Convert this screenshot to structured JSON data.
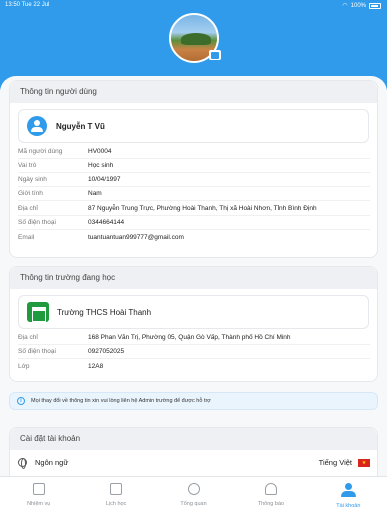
{
  "status_bar": {
    "time": "13:50",
    "date": "Tue 22 Jul",
    "battery": "100%"
  },
  "user_section": {
    "title": "Thông tin người dùng",
    "name": "Nguyễn T Vũ",
    "fields": [
      {
        "label": "Mã người dùng",
        "value": "HV0004"
      },
      {
        "label": "Vai trò",
        "value": "Học sinh"
      },
      {
        "label": "Ngày sinh",
        "value": "10/04/1997"
      },
      {
        "label": "Giới tính",
        "value": "Nam"
      },
      {
        "label": "Địa chỉ",
        "value": "87 Nguyễn Trung Trực, Phường Hoài Thanh, Thị xã Hoài Nhơn, Tỉnh Bình Định"
      },
      {
        "label": "Số điện thoại",
        "value": "0344664144"
      },
      {
        "label": "Email",
        "value": "tuantuantuan999777@gmail.com"
      }
    ]
  },
  "school_section": {
    "title": "Thông tin trường đang học",
    "name": "Trường THCS Hoài Thanh",
    "fields": [
      {
        "label": "Địa chỉ",
        "value": "168 Phan Văn Trị, Phường 05, Quận Gò Vấp, Thành phố Hồ Chí Minh"
      },
      {
        "label": "Số điện thoại",
        "value": "0927052025"
      },
      {
        "label": "Lớp",
        "value": "12A8"
      }
    ]
  },
  "notice": {
    "text": "Mọi thay đổi về thông tin xin vui lòng liên hệ Admin trường để được hỗ trợ"
  },
  "settings_section": {
    "title": "Cài đặt tài khoản",
    "language_label": "Ngôn ngữ",
    "language_value": "Tiếng Việt"
  },
  "tabs": [
    {
      "label": "Nhiệm vụ",
      "icon": "task-icon"
    },
    {
      "label": "Lịch học",
      "icon": "calendar-icon"
    },
    {
      "label": "Tổng quan",
      "icon": "dashboard-icon"
    },
    {
      "label": "Thông báo",
      "icon": "bell-icon"
    },
    {
      "label": "Tài khoản",
      "icon": "user-icon",
      "active": true
    }
  ],
  "colors": {
    "accent": "#2f9bea",
    "school_icon": "#1f9a3f"
  }
}
